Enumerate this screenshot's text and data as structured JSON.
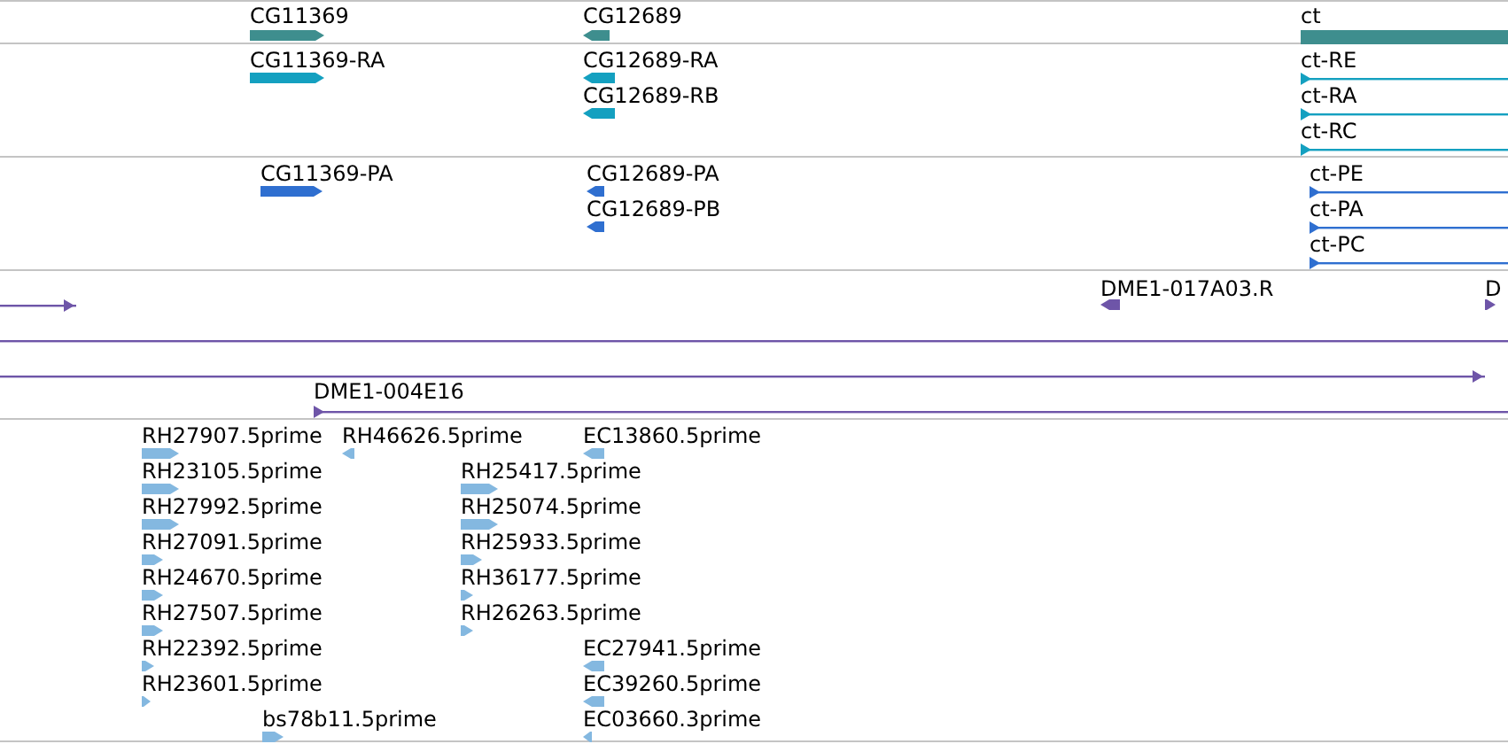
{
  "tracks": [
    {
      "features": [
        {
          "label": "CG11369",
          "kind": "bar",
          "forward": true
        },
        {
          "label": "CG12689",
          "kind": "bar",
          "forward": false
        },
        {
          "label": "ct",
          "kind": "bar"
        }
      ]
    },
    {
      "features": [
        {
          "label": "CG11369-RA",
          "kind": "bar",
          "forward": true
        },
        {
          "label": "CG12689-RA",
          "kind": "bar",
          "forward": false
        },
        {
          "label": "CG12689-RB",
          "kind": "bar",
          "forward": false
        },
        {
          "label": "ct-RE",
          "kind": "line",
          "forward": true
        },
        {
          "label": "ct-RA",
          "kind": "line",
          "forward": true
        },
        {
          "label": "ct-RC",
          "kind": "line",
          "forward": true
        }
      ]
    },
    {
      "features": [
        {
          "label": "CG11369-PA",
          "kind": "bar",
          "forward": true
        },
        {
          "label": "CG12689-PA",
          "kind": "bar",
          "forward": false
        },
        {
          "label": "CG12689-PB",
          "kind": "bar",
          "forward": false
        },
        {
          "label": "ct-PE",
          "kind": "line",
          "forward": true
        },
        {
          "label": "ct-PA",
          "kind": "line",
          "forward": true
        },
        {
          "label": "ct-PC",
          "kind": "line",
          "forward": true
        }
      ]
    },
    {
      "features": [
        {
          "kind": "line",
          "forward": true
        },
        {
          "label": "DME1-017A03.R",
          "kind": "bar",
          "forward": false
        },
        {
          "label": "D",
          "kind": "bar",
          "forward": true
        },
        {
          "kind": "line"
        },
        {
          "kind": "line",
          "forward": true
        },
        {
          "label": "DME1-004E16",
          "kind": "line",
          "forward": true
        }
      ]
    },
    {
      "features": [
        {
          "label": "RH27907.5prime",
          "kind": "bar",
          "forward": true
        },
        {
          "label": "RH46626.5prime",
          "kind": "bar",
          "forward": false
        },
        {
          "label": "EC13860.5prime",
          "kind": "bar",
          "forward": false
        },
        {
          "label": "RH23105.5prime",
          "kind": "bar",
          "forward": true
        },
        {
          "label": "RH25417.5prime",
          "kind": "bar",
          "forward": true
        },
        {
          "label": "RH27992.5prime",
          "kind": "bar",
          "forward": true
        },
        {
          "label": "RH25074.5prime",
          "kind": "bar",
          "forward": true
        },
        {
          "label": "RH27091.5prime",
          "kind": "bar",
          "forward": true
        },
        {
          "label": "RH25933.5prime",
          "kind": "bar",
          "forward": true
        },
        {
          "label": "RH24670.5prime",
          "kind": "bar",
          "forward": true
        },
        {
          "label": "RH36177.5prime",
          "kind": "bar",
          "forward": true
        },
        {
          "label": "RH27507.5prime",
          "kind": "bar",
          "forward": true
        },
        {
          "label": "RH26263.5prime",
          "kind": "bar",
          "forward": true
        },
        {
          "label": "RH22392.5prime",
          "kind": "bar",
          "forward": true
        },
        {
          "label": "EC27941.5prime",
          "kind": "bar",
          "forward": false
        },
        {
          "label": "RH23601.5prime",
          "kind": "bar",
          "forward": true
        },
        {
          "label": "EC39260.5prime",
          "kind": "bar",
          "forward": false
        },
        {
          "label": "bs78b11.5prime",
          "kind": "bar",
          "forward": true
        },
        {
          "label": "EC03660.3prime",
          "kind": "bar",
          "forward": false
        }
      ]
    }
  ]
}
